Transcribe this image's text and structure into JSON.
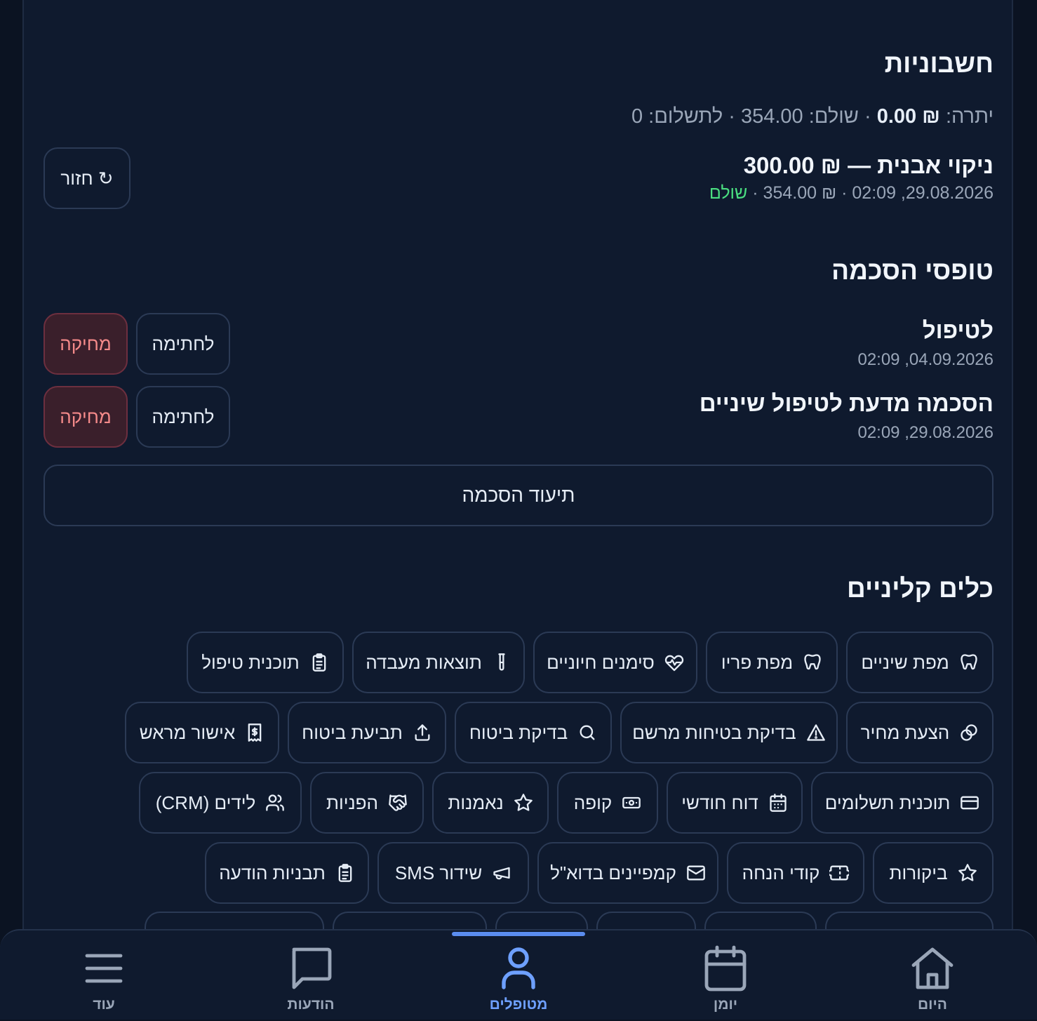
{
  "invoices": {
    "heading": "חשבוניות",
    "summary": {
      "balance_label": "יתרה:",
      "balance_value": "₪ 0.00",
      "paid_label": "· שולם:",
      "paid_value": "354.00",
      "due_label": "· לתשלום:",
      "due_value": "0"
    },
    "refund_button": "↻ חזור",
    "items": [
      {
        "title": "ניקוי אבנית — ₪ 300.00",
        "meta": "29.08.2026, 02:09 · ₪ 354.00 ·",
        "status": "שולם"
      }
    ]
  },
  "consent_forms": {
    "heading": "טופסי הסכמה",
    "sign_label": "לחתימה",
    "delete_label": "מחיקה",
    "items": [
      {
        "title": "לטיפול",
        "date": "04.09.2026, 02:09"
      },
      {
        "title": "הסכמה מדעת לטיפול שיניים",
        "date": "29.08.2026, 02:09"
      }
    ],
    "document_button": "תיעוד הסכמה"
  },
  "clinical_tools": {
    "heading": "כלים קליניים",
    "rows": [
      [
        {
          "label": "מפת שיניים",
          "icon": "tooth-icon"
        },
        {
          "label": "מפת פריו",
          "icon": "tooth-icon"
        },
        {
          "label": "סימנים חיוניים",
          "icon": "heart-pulse-icon"
        },
        {
          "label": "תוצאות מעבדה",
          "icon": "test-tube-icon"
        },
        {
          "label": "תוכנית טיפול",
          "icon": "clipboard-icon"
        }
      ],
      [
        {
          "label": "הצעת מחיר",
          "icon": "coins-icon"
        },
        {
          "label": "בדיקת בטיחות מרשם",
          "icon": "warning-icon"
        },
        {
          "label": "בדיקת ביטוח",
          "icon": "search-icon"
        },
        {
          "label": "תביעת ביטוח",
          "icon": "upload-icon"
        },
        {
          "label": "אישור מראש",
          "icon": "receipt-icon"
        }
      ],
      [
        {
          "label": "תוכנית תשלומים",
          "icon": "credit-card-icon"
        },
        {
          "label": "דוח חודשי",
          "icon": "calendar-icon"
        },
        {
          "label": "קופה",
          "icon": "cash-icon"
        },
        {
          "label": "נאמנות",
          "icon": "star-icon"
        },
        {
          "label": "הפניות",
          "icon": "handshake-icon"
        },
        {
          "label": "לידים (CRM)",
          "icon": "users-icon"
        }
      ],
      [
        {
          "label": "ביקורות",
          "icon": "star-icon"
        },
        {
          "label": "קודי הנחה",
          "icon": "ticket-icon"
        },
        {
          "label": "קמפיינים בדוא\"ל",
          "icon": "mail-icon"
        },
        {
          "label": "שידור SMS",
          "icon": "megaphone-icon"
        },
        {
          "label": "תבניות הודעה",
          "icon": "clipboard-icon"
        }
      ]
    ]
  },
  "bottom_nav": {
    "items": [
      {
        "label": "היום",
        "icon": "home-icon"
      },
      {
        "label": "יומן",
        "icon": "calendar-icon"
      },
      {
        "label": "מטופלים",
        "icon": "user-icon",
        "active": true
      },
      {
        "label": "הודעות",
        "icon": "chat-icon"
      },
      {
        "label": "עוד",
        "icon": "menu-icon"
      }
    ]
  },
  "colors": {
    "background": "#0f1a2e",
    "accent": "#5b8def",
    "success": "#4ade80",
    "danger_text": "#f58a8a"
  }
}
